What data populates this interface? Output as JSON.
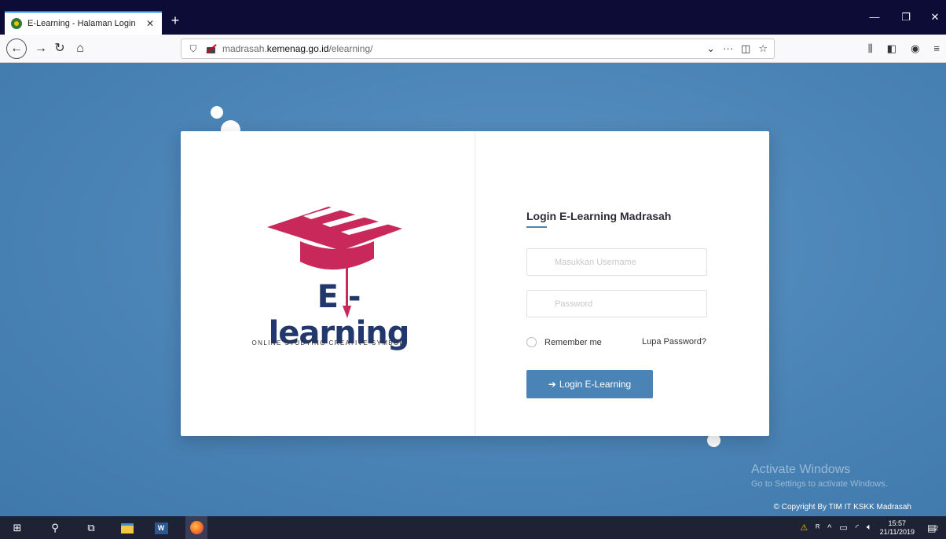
{
  "browser": {
    "tab_title": "E-Learning - Halaman Login",
    "tab_close": "✕",
    "new_tab": "+",
    "url_host_prefix": "madrasah.",
    "url_domain": "kemenag.go.id",
    "url_path": "/elearning/",
    "window_controls": [
      "—",
      "❐",
      "✕"
    ],
    "toolbar_icons": [
      "library-icon",
      "sidebar-icon",
      "account-icon",
      "menu-icon"
    ]
  },
  "branding": {
    "logo_text": "E - learning",
    "tagline": "ONLINE STUDYING CREATIVE SYMBOL",
    "colors": {
      "logo_red": "#c8285a",
      "logo_navy": "#22376b"
    }
  },
  "login": {
    "title": "Login E-Learning Madrasah",
    "username_placeholder": "Masukkan Username",
    "password_placeholder": "Password",
    "remember_label": "Remember me",
    "forgot_label": "Lupa Password?",
    "submit_label": "Login E-Learning",
    "accent_color": "#4a83b5"
  },
  "watermark": {
    "line1": "Activate Windows",
    "line2": "Go to Settings to activate Windows."
  },
  "footer": {
    "copyright": "© Copyright By TIM IT KSKK Madrasah"
  },
  "taskbar": {
    "time": "15:57",
    "date": "21/11/2019",
    "notification_count": "2"
  }
}
